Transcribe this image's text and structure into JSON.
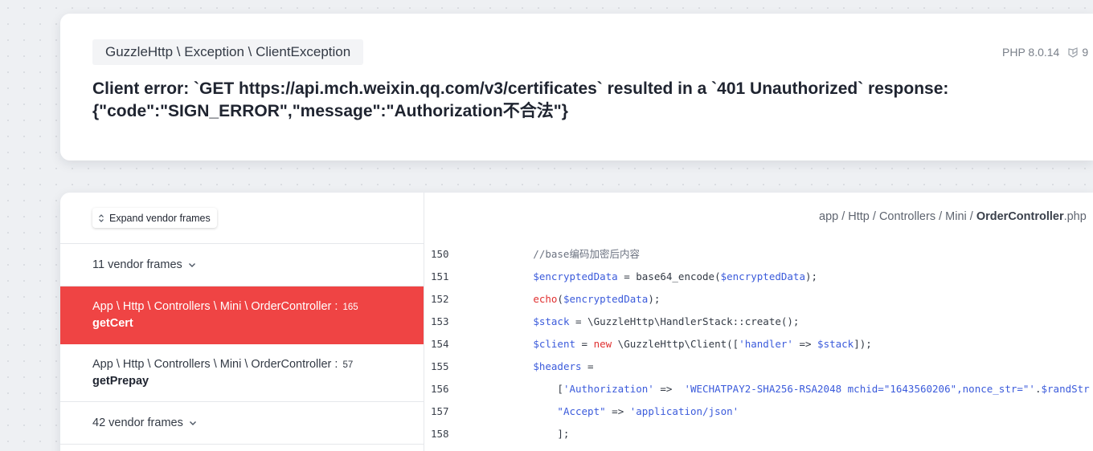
{
  "header": {
    "exception_class": "GuzzleHttp \\ Exception \\ ClientException",
    "php_version": "PHP 8.0.14",
    "laravel_version": "9",
    "message": "Client error: `GET https://api.mch.weixin.qq.com/v3/certificates` resulted in a `401 Unauthorized` response:\n{\"code\":\"SIGN_ERROR\",\"message\":\"Authorization不合法\"}"
  },
  "frames": {
    "expand_label": "Expand vendor frames",
    "vendor_group_1": "11 vendor frames",
    "vendor_group_2": "42 vendor frames",
    "items": [
      {
        "class": "App \\ Http \\ Controllers \\ Mini \\ OrderController",
        "line": "165",
        "method": "getCert"
      },
      {
        "class": "App \\ Http \\ Controllers \\ Mini \\ OrderController",
        "line": "57",
        "method": "getPrepay"
      }
    ]
  },
  "code": {
    "file_path_prefix": "app / Http / Controllers / Mini / ",
    "file_name": "OrderController",
    "file_ext": ".php",
    "lines": [
      {
        "n": "150",
        "tokens": [
          {
            "t": "com",
            "v": "            //base编码加密后内容"
          }
        ]
      },
      {
        "n": "151",
        "tokens": [
          {
            "t": "txt",
            "v": "            "
          },
          {
            "t": "var",
            "v": "$encryptedData"
          },
          {
            "t": "txt",
            "v": " = base64_encode("
          },
          {
            "t": "var",
            "v": "$encryptedData"
          },
          {
            "t": "txt",
            "v": ");"
          }
        ]
      },
      {
        "n": "152",
        "tokens": [
          {
            "t": "txt",
            "v": "            "
          },
          {
            "t": "kw",
            "v": "echo"
          },
          {
            "t": "txt",
            "v": "("
          },
          {
            "t": "var",
            "v": "$encryptedData"
          },
          {
            "t": "txt",
            "v": ");"
          }
        ]
      },
      {
        "n": "153",
        "tokens": [
          {
            "t": "txt",
            "v": "            "
          },
          {
            "t": "var",
            "v": "$stack"
          },
          {
            "t": "txt",
            "v": " = \\GuzzleHttp\\HandlerStack::create();"
          }
        ]
      },
      {
        "n": "154",
        "tokens": [
          {
            "t": "txt",
            "v": "            "
          },
          {
            "t": "var",
            "v": "$client"
          },
          {
            "t": "txt",
            "v": " = "
          },
          {
            "t": "kw",
            "v": "new"
          },
          {
            "t": "txt",
            "v": " \\GuzzleHttp\\Client(["
          },
          {
            "t": "str",
            "v": "'handler'"
          },
          {
            "t": "txt",
            "v": " => "
          },
          {
            "t": "var",
            "v": "$stack"
          },
          {
            "t": "txt",
            "v": "]);"
          }
        ]
      },
      {
        "n": "155",
        "tokens": [
          {
            "t": "txt",
            "v": "            "
          },
          {
            "t": "var",
            "v": "$headers"
          },
          {
            "t": "txt",
            "v": " ="
          }
        ]
      },
      {
        "n": "156",
        "tokens": [
          {
            "t": "txt",
            "v": "                ["
          },
          {
            "t": "str",
            "v": "'Authorization'"
          },
          {
            "t": "txt",
            "v": " =>  "
          },
          {
            "t": "str",
            "v": "'WECHATPAY2-SHA256-RSA2048 mchid=\"1643560206\",nonce_str=\"'"
          },
          {
            "t": "txt",
            "v": "."
          },
          {
            "t": "var",
            "v": "$randStr"
          }
        ]
      },
      {
        "n": "157",
        "tokens": [
          {
            "t": "txt",
            "v": "                "
          },
          {
            "t": "str",
            "v": "\"Accept\""
          },
          {
            "t": "txt",
            "v": " => "
          },
          {
            "t": "str",
            "v": "'application/json'"
          }
        ]
      },
      {
        "n": "158",
        "tokens": [
          {
            "t": "txt",
            "v": "                ];"
          }
        ]
      }
    ]
  }
}
